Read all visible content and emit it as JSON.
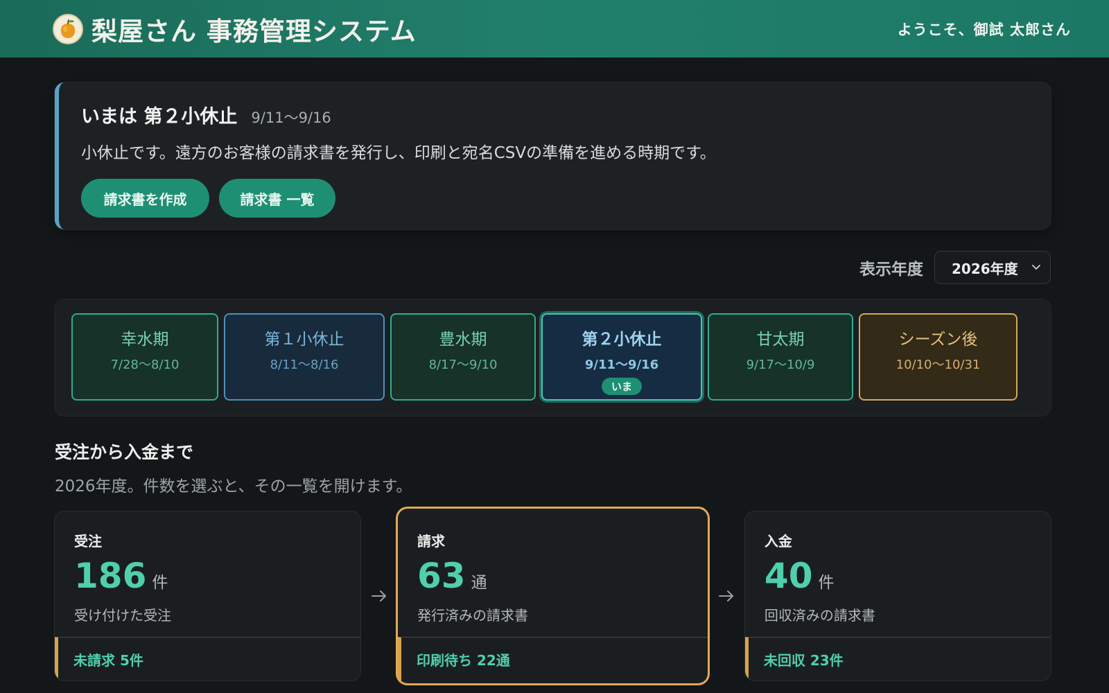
{
  "header": {
    "title": "梨屋さん 事務管理システム",
    "welcome": "ようこそ、御試 太郎さん",
    "logo_icon": "pear-fruit-icon"
  },
  "notice": {
    "title": "いまは 第２小休止",
    "dates": "9/11〜9/16",
    "text": "小休止です。遠方のお客様の請求書を発行し、印刷と宛名CSVの準備を進める時期です。",
    "buttons": {
      "create": "請求書を作成",
      "list": "請求書 一覧"
    },
    "accent": "#5aa3c7"
  },
  "year_selector": {
    "label": "表示年度",
    "value": "2026年度"
  },
  "periods": [
    {
      "name": "幸水期",
      "dates": "7/28〜8/10",
      "style": "green"
    },
    {
      "name": "第１小休止",
      "dates": "8/11〜8/16",
      "style": "blue"
    },
    {
      "name": "豊水期",
      "dates": "8/17〜9/10",
      "style": "green"
    },
    {
      "name": "第２小休止",
      "dates": "9/11〜9/16",
      "style": "current",
      "badge": "いま"
    },
    {
      "name": "甘太期",
      "dates": "9/17〜10/9",
      "style": "green"
    },
    {
      "name": "シーズン後",
      "dates": "10/10〜10/31",
      "style": "orange"
    }
  ],
  "flow": {
    "title": "受注から入金まで",
    "subtitle": "2026年度。件数を選ぶと、その一覧を開けます。",
    "cards": [
      {
        "label": "受注",
        "count": "186",
        "unit": "件",
        "desc": "受け付けた受注",
        "footer": "未請求 5件"
      },
      {
        "label": "請求",
        "count": "63",
        "unit": "通",
        "desc": "発行済みの請求書",
        "footer": "印刷待ち 22通",
        "active": true
      },
      {
        "label": "入金",
        "count": "40",
        "unit": "件",
        "desc": "回収済みの請求書",
        "footer": "未回収 23件"
      }
    ]
  },
  "colors": {
    "brand": "#1f8f73",
    "count": "#4fcfae",
    "highlight": "#e0aa55"
  }
}
